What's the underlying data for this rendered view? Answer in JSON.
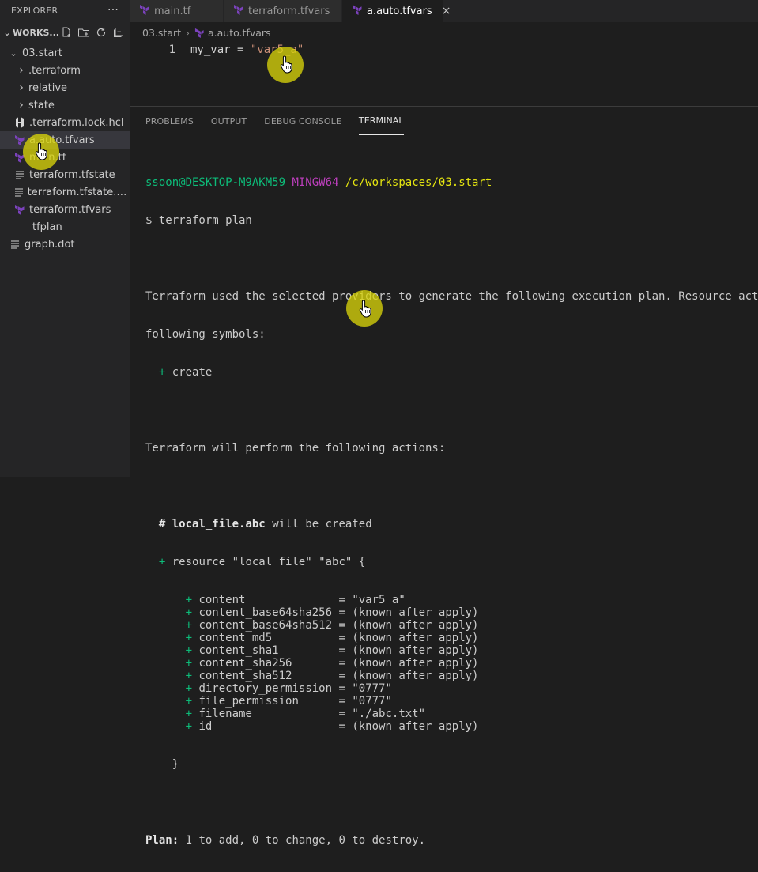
{
  "sidebar": {
    "title": "EXPLORER",
    "more": "···",
    "workspace": "WORKS...",
    "folder": "03.start",
    "items": [
      {
        "label": ".terraform",
        "kind": "folder",
        "icon": "chevron-right-icon"
      },
      {
        "label": "relative",
        "kind": "folder",
        "icon": "chevron-right-icon"
      },
      {
        "label": "state",
        "kind": "folder",
        "icon": "chevron-right-icon"
      },
      {
        "label": ".terraform.lock.hcl",
        "kind": "hcl",
        "icon": "hashicorp-icon"
      },
      {
        "label": "a.auto.tfvars",
        "kind": "tf",
        "icon": "terraform-icon",
        "selected": true
      },
      {
        "label": "main.tf",
        "kind": "tf",
        "icon": "terraform-icon"
      },
      {
        "label": "terraform.tfstate",
        "kind": "text",
        "icon": "lines-icon"
      },
      {
        "label": "terraform.tfstate.bac...",
        "kind": "text",
        "icon": "lines-icon"
      },
      {
        "label": "terraform.tfvars",
        "kind": "tf",
        "icon": "terraform-icon"
      },
      {
        "label": "tfplan",
        "kind": "plain",
        "icon": ""
      },
      {
        "label": "graph.dot",
        "kind": "text",
        "icon": "lines-icon"
      }
    ]
  },
  "tabs": [
    {
      "label": "main.tf",
      "active": false
    },
    {
      "label": "terraform.tfvars",
      "active": false
    },
    {
      "label": "a.auto.tfvars",
      "active": true
    }
  ],
  "tab_close": "×",
  "breadcrumb": {
    "folder": "03.start",
    "sep": "›",
    "file": "a.auto.tfvars"
  },
  "editor": {
    "line_number": "1",
    "code_key": "my_var = ",
    "code_value": "\"var5_a\""
  },
  "panel": {
    "tabs": [
      "PROBLEMS",
      "OUTPUT",
      "DEBUG CONSOLE",
      "TERMINAL"
    ],
    "active_tab": "TERMINAL"
  },
  "terminal": {
    "prompt_user": "ssoon@DESKTOP-M9AKM59",
    "prompt_shell": "MINGW64",
    "prompt_path": "/c/workspaces/03.start",
    "command": "$ terraform plan",
    "msg1": "Terraform used the selected providers to generate the following execution plan. Resource actions",
    "msg2": "following symbols:",
    "plus_create_sign": "+",
    "plus_create_text": "create",
    "msg3": "Terraform will perform the following actions:",
    "resource_comment_hash": "#",
    "resource_name": "local_file.abc",
    "resource_comment_rest": "will be created",
    "resource_header": "resource \"local_file\" \"abc\" {",
    "attributes": [
      {
        "name": "content              ",
        "value": "\"var5_a\""
      },
      {
        "name": "content_base64sha256 ",
        "value": "(known after apply)"
      },
      {
        "name": "content_base64sha512 ",
        "value": "(known after apply)"
      },
      {
        "name": "content_md5          ",
        "value": "(known after apply)"
      },
      {
        "name": "content_sha1         ",
        "value": "(known after apply)"
      },
      {
        "name": "content_sha256       ",
        "value": "(known after apply)"
      },
      {
        "name": "content_sha512       ",
        "value": "(known after apply)"
      },
      {
        "name": "directory_permission ",
        "value": "\"0777\""
      },
      {
        "name": "file_permission      ",
        "value": "\"0777\""
      },
      {
        "name": "filename             ",
        "value": "\"./abc.txt\""
      },
      {
        "name": "id                   ",
        "value": "(known after apply)"
      }
    ],
    "close_brace": "}",
    "plan_label": "Plan:",
    "plan_text": "1 to add, 0 to change, 0 to destroy."
  },
  "colors": {
    "terraform": "#7b42bc",
    "terminal_green": "#0dbc79",
    "terminal_purple": "#bc3fbc",
    "terminal_yellow": "#e5e510",
    "cursor_highlight": "#d7d20a"
  }
}
